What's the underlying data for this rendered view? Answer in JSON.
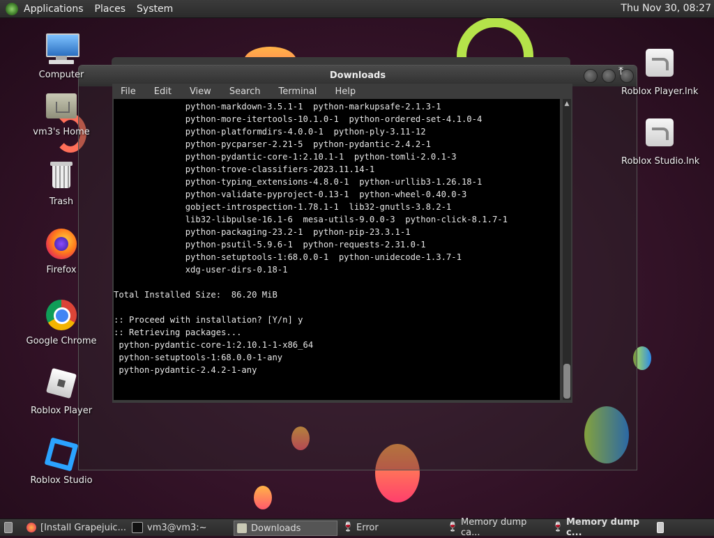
{
  "top_panel": {
    "menus": [
      "Applications",
      "Places",
      "System"
    ],
    "clock": "Thu Nov 30, 08:27"
  },
  "desktop_icons": [
    {
      "label": "Computer",
      "icon": "computer-icon"
    },
    {
      "label": "vm3's Home",
      "icon": "home-folder-icon"
    },
    {
      "label": "Trash",
      "icon": "trash-icon"
    },
    {
      "label": "Firefox",
      "icon": "firefox-icon"
    },
    {
      "label": "Google Chrome",
      "icon": "chrome-icon"
    },
    {
      "label": "Roblox Player",
      "icon": "roblox-player-icon"
    },
    {
      "label": "Roblox Studio",
      "icon": "roblox-studio-icon"
    },
    {
      "label": "Roblox Player.lnk",
      "icon": "shortcut-file-icon"
    },
    {
      "label": "Roblox Studio.lnk",
      "icon": "shortcut-file-icon"
    }
  ],
  "window": {
    "title": "Downloads",
    "menu": [
      "File",
      "Edit",
      "View",
      "Search",
      "Terminal",
      "Help"
    ]
  },
  "terminal_lines": [
    "              python-markdown-3.5.1-1  python-markupsafe-2.1.3-1",
    "              python-more-itertools-10.1.0-1  python-ordered-set-4.1.0-4",
    "              python-platformdirs-4.0.0-1  python-ply-3.11-12",
    "              python-pycparser-2.21-5  python-pydantic-2.4.2-1",
    "              python-pydantic-core-1:2.10.1-1  python-tomli-2.0.1-3",
    "              python-trove-classifiers-2023.11.14-1",
    "              python-typing_extensions-4.8.0-1  python-urllib3-1.26.18-1",
    "              python-validate-pyproject-0.13-1  python-wheel-0.40.0-3",
    "              gobject-introspection-1.78.1-1  lib32-gnutls-3.8.2-1",
    "              lib32-libpulse-16.1-6  mesa-utils-9.0.0-3  python-click-8.1.7-1",
    "              python-packaging-23.2-1  python-pip-23.3.1-1",
    "              python-psutil-5.9.6-1  python-requests-2.31.0-1",
    "              python-setuptools-1:68.0.0-1  python-unidecode-1.3.7-1",
    "              xdg-user-dirs-0.18-1",
    "",
    "Total Installed Size:  86.20 MiB",
    "",
    ":: Proceed with installation? [Y/n] y",
    ":: Retrieving packages...",
    " python-pydantic-core-1:2.10.1-1-x86_64",
    " python-setuptools-1:68.0.0-1-any",
    " python-pydantic-2.4.2-1-any"
  ],
  "taskbar": {
    "items": [
      {
        "label": "[Install Grapejuic...",
        "icon": "firefox-icon"
      },
      {
        "label": "vm3@vm3:~",
        "icon": "terminal-icon"
      },
      {
        "label": "Downloads",
        "icon": "folder-icon",
        "active": true
      },
      {
        "label": "Error",
        "icon": "wine-icon"
      },
      {
        "label": "Memory dump ca...",
        "icon": "wine-icon"
      },
      {
        "label": "Memory dump c...",
        "icon": "wine-icon",
        "bold": true
      }
    ]
  },
  "colors": {
    "terminal_bg": "#000000",
    "panel_bg": "#2f2f2f",
    "desktop_bg": "#341328"
  }
}
